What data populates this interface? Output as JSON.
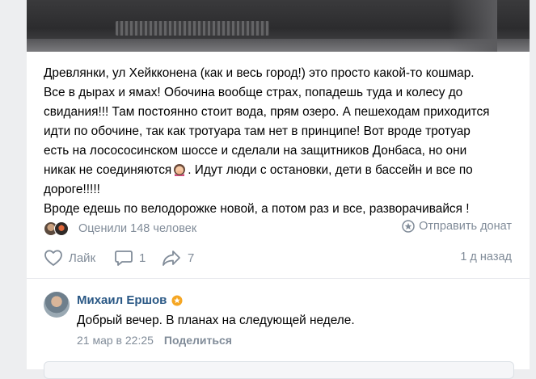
{
  "post": {
    "text_lines": [
      "Древлянки, ул Хейкконена (как и весь город!) это просто какой-то кошмар.",
      "Все в дырах и ямах! Обочина вообще страх, попадешь туда и колесу до",
      "свидания!!! Там постоянно стоит вода, прям озеро. А пешеходам приходится",
      "идти по обочине, так как тротуара там нет в принципе! Вот вроде тротуар",
      "есть на лосососинском шоссе и сделали на защитников Донбаса, но они",
      "никак не соединяются",
      ". Идут люди с остановки, дети в бассейн и все по",
      "дороге!!!!!",
      "Вроде едешь по велодорожке новой, а потом раз и все, разворачивайся !"
    ],
    "rated_text": "Оценили 148 человек",
    "donate_text": "Отправить донат",
    "like_label": "Лайк",
    "comments_count": "1",
    "shares_count": "7",
    "time_ago": "1 д назад"
  },
  "comment": {
    "author": "Михаил Ершов",
    "text": "Добрый вечер. В планах на следующей неделе.",
    "date": "21 мар в 22:25",
    "share_label": "Поделиться"
  },
  "icons": {
    "emoji": "woman-facepalm-emoji",
    "star": "verified-star-icon",
    "donate": "donate-icon",
    "like": "heart-icon",
    "comment": "comment-icon",
    "share": "share-arrow-icon"
  },
  "colors": {
    "link": "#2a5885",
    "muted": "#818c99",
    "star": "#f5a623"
  }
}
